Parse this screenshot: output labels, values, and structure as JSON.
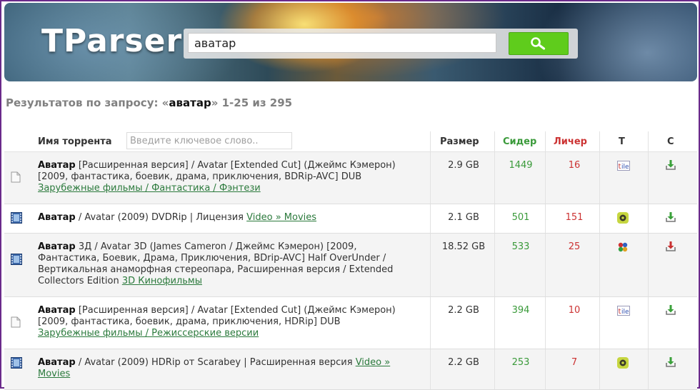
{
  "header": {
    "logo": "TParser",
    "search_value": "аватар",
    "search_button_icon": "search-icon"
  },
  "summary": {
    "prefix": "Результатов по запросу: «",
    "query": "аватар",
    "suffix": "» 1-25 из 295"
  },
  "table": {
    "columns": {
      "name": "Имя торрента",
      "size": "Размер",
      "seeders": "Сидер",
      "leechers": "Личер",
      "t": "T",
      "c": "C"
    },
    "filter_placeholder": "Введите ключевое слово..",
    "colors": {
      "seeders": "#3a9a3a",
      "leechers": "#cc3333",
      "link": "#2b7a3c"
    },
    "rows": [
      {
        "type_icon": "document-icon",
        "title": "Аватар",
        "desc": " [Расширенная версия] / Avatar [Extended Cut] (Джеймс Кэмерон) [2009, фантастика, боевик, драма, приключения, BDRip-AVC] DUB ",
        "category": "Зарубежные фильмы / Фантастика / Фэнтези",
        "size": "2.9 GB",
        "seeders": "1449",
        "leechers": "16",
        "tracker_icon": "tfile-icon",
        "download_icon": "download-icon"
      },
      {
        "type_icon": "film-icon",
        "title": "Аватар",
        "desc": " / Avatar (2009) DVDRip | Лицензия ",
        "category": "Video » Movies",
        "size": "2.1 GB",
        "seeders": "501",
        "leechers": "151",
        "tracker_icon": "circle-tracker-icon",
        "download_icon": "download-icon"
      },
      {
        "type_icon": "film-icon",
        "title": "Аватар",
        "desc": " 3Д / Avatar 3D (James Cameron / Джеймс Кэмерон) [2009, Фантастика, Боевик, Драма, Приключения, BDrip-AVC] Half OverUnder / Вертикальная анаморфная стереопара, Расширенная версия / Extended Collectors Edition ",
        "category": "3D Кинофильмы",
        "size": "18.52 GB",
        "seeders": "533",
        "leechers": "25",
        "tracker_icon": "puzzle-tracker-icon",
        "download_icon": "download-red-icon"
      },
      {
        "type_icon": "document-icon",
        "title": "Аватар",
        "desc": " [Расширенная версия] / Avatar [Extended Cut] (Джеймс Кэмерон) [2009, фантастика, боевик, драма, приключения, HDRip] DUB ",
        "category": "Зарубежные фильмы / Режиссерские версии",
        "size": "2.2 GB",
        "seeders": "394",
        "leechers": "10",
        "tracker_icon": "tfile-icon",
        "download_icon": "download-icon"
      },
      {
        "type_icon": "film-icon",
        "title": "Аватар",
        "desc": " / Avatar (2009) HDRip от Scarabey | Расширенная версия ",
        "category": "Video » Movies",
        "size": "2.2 GB",
        "seeders": "253",
        "leechers": "7",
        "tracker_icon": "circle-tracker-icon",
        "download_icon": "download-icon"
      }
    ]
  }
}
